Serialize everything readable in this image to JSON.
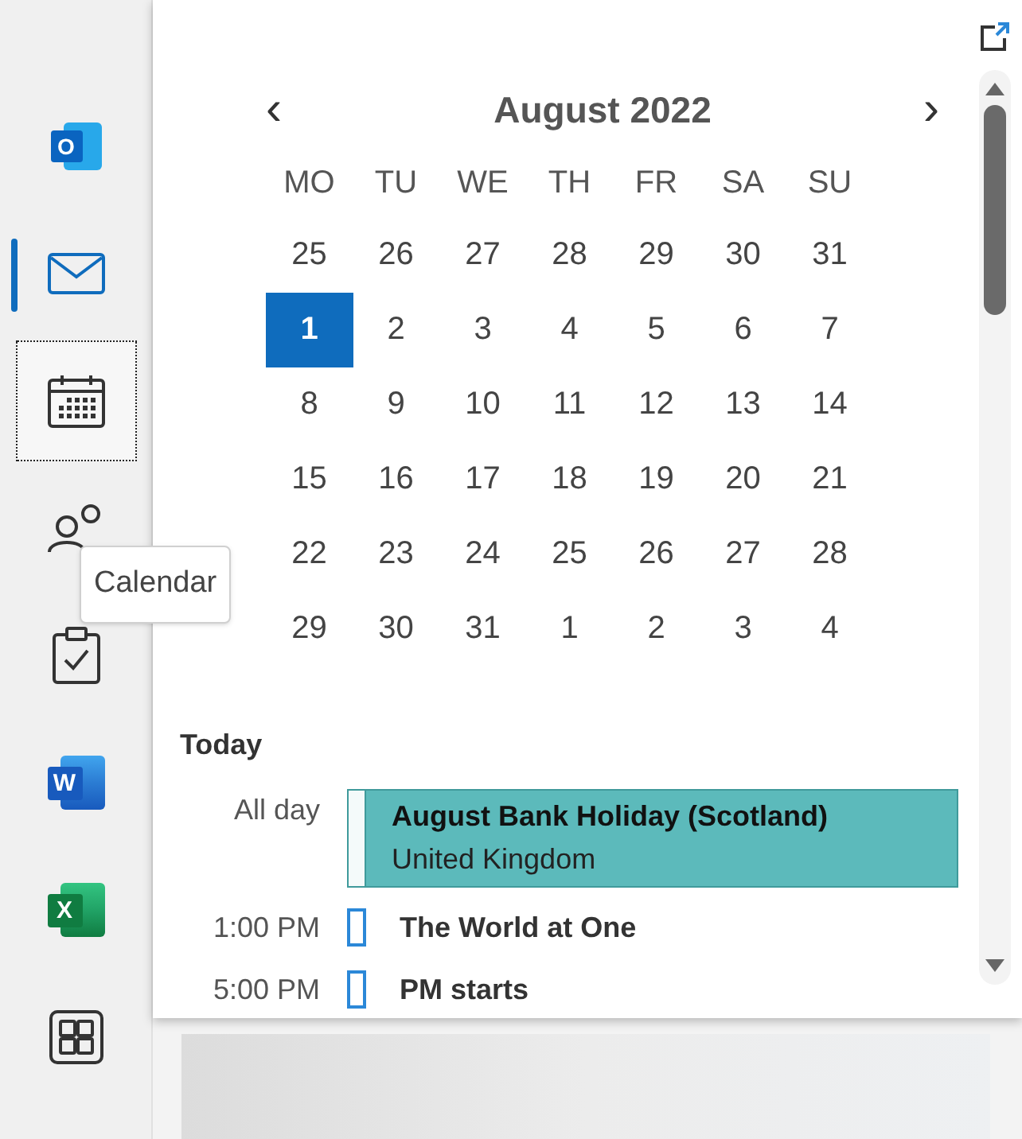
{
  "rail": {
    "items": [
      {
        "kind": "outlook",
        "logo_letter": "O",
        "selected": false,
        "focused": false
      },
      {
        "kind": "mail",
        "selected": true,
        "focused": false
      },
      {
        "kind": "calendar",
        "selected": false,
        "focused": true
      },
      {
        "kind": "people",
        "selected": false,
        "focused": false
      },
      {
        "kind": "tasks",
        "selected": false,
        "focused": false
      },
      {
        "kind": "word",
        "logo_letter": "W",
        "selected": false,
        "focused": false
      },
      {
        "kind": "excel",
        "logo_letter": "X",
        "selected": false,
        "focused": false
      },
      {
        "kind": "apps",
        "selected": false,
        "focused": false
      }
    ]
  },
  "tooltip": {
    "text": "Calendar"
  },
  "calendar": {
    "month": "August 2022",
    "prev": "‹",
    "next": "›",
    "weekdays": [
      "MO",
      "TU",
      "WE",
      "TH",
      "FR",
      "SA",
      "SU"
    ],
    "weeks": [
      [
        {
          "day": "25",
          "selected": false
        },
        {
          "day": "26",
          "selected": false
        },
        {
          "day": "27",
          "selected": false
        },
        {
          "day": "28",
          "selected": false
        },
        {
          "day": "29",
          "selected": false
        },
        {
          "day": "30",
          "selected": false
        },
        {
          "day": "31",
          "selected": false
        }
      ],
      [
        {
          "day": "1",
          "selected": true
        },
        {
          "day": "2",
          "selected": false
        },
        {
          "day": "3",
          "selected": false
        },
        {
          "day": "4",
          "selected": false
        },
        {
          "day": "5",
          "selected": false
        },
        {
          "day": "6",
          "selected": false
        },
        {
          "day": "7",
          "selected": false
        }
      ],
      [
        {
          "day": "8",
          "selected": false
        },
        {
          "day": "9",
          "selected": false
        },
        {
          "day": "10",
          "selected": false
        },
        {
          "day": "11",
          "selected": false
        },
        {
          "day": "12",
          "selected": false
        },
        {
          "day": "13",
          "selected": false
        },
        {
          "day": "14",
          "selected": false
        }
      ],
      [
        {
          "day": "15",
          "selected": false
        },
        {
          "day": "16",
          "selected": false
        },
        {
          "day": "17",
          "selected": false
        },
        {
          "day": "18",
          "selected": false
        },
        {
          "day": "19",
          "selected": false
        },
        {
          "day": "20",
          "selected": false
        },
        {
          "day": "21",
          "selected": false
        }
      ],
      [
        {
          "day": "22",
          "selected": false
        },
        {
          "day": "23",
          "selected": false
        },
        {
          "day": "24",
          "selected": false
        },
        {
          "day": "25",
          "selected": false
        },
        {
          "day": "26",
          "selected": false
        },
        {
          "day": "27",
          "selected": false
        },
        {
          "day": "28",
          "selected": false
        }
      ],
      [
        {
          "day": "29",
          "selected": false
        },
        {
          "day": "30",
          "selected": false
        },
        {
          "day": "31",
          "selected": false
        },
        {
          "day": "1",
          "selected": false
        },
        {
          "day": "2",
          "selected": false
        },
        {
          "day": "3",
          "selected": false
        },
        {
          "day": "4",
          "selected": false
        }
      ]
    ]
  },
  "agenda": {
    "heading": "Today",
    "events": [
      {
        "kind": "all_day",
        "time": "All day",
        "title": "August Bank Holiday (Scotland)",
        "subtitle": "United Kingdom",
        "color": "#5cbabb"
      },
      {
        "kind": "timed",
        "time": "1:00 PM",
        "title": "The World at One",
        "color": "#2b88d8"
      },
      {
        "kind": "timed",
        "time": "5:00 PM",
        "title": "PM starts",
        "color": "#2b88d8"
      }
    ]
  }
}
